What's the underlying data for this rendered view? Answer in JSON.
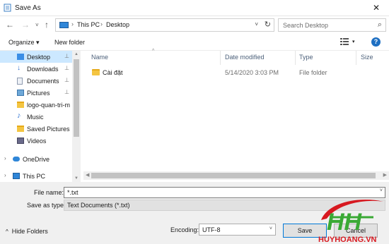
{
  "window": {
    "title": "Save As",
    "close_glyph": "✕"
  },
  "nav": {
    "back": "←",
    "forward": "→",
    "recent": "˅",
    "up": "↑",
    "address": {
      "seg1": "This PC",
      "seg2": "Desktop",
      "sep": "›",
      "drop": "˅",
      "refresh": "↻"
    },
    "search_placeholder": "Search Desktop",
    "search_glyph": "⌕"
  },
  "toolbar": {
    "organize": "Organize ▾",
    "new_folder": "New folder",
    "help": "?"
  },
  "sidebar": {
    "items": [
      {
        "label": "Desktop",
        "icon": "desktop-icon",
        "color": "#3a8ee6"
      },
      {
        "label": "Downloads",
        "icon": "download-icon",
        "color": "#2f6fcf"
      },
      {
        "label": "Documents",
        "icon": "documents-icon",
        "color": "#8f9bb0"
      },
      {
        "label": "Pictures",
        "icon": "pictures-icon",
        "color": "#6ea8d8"
      },
      {
        "label": "logo-quan-tri-m",
        "icon": "folder-icon",
        "color": "#f4c542"
      },
      {
        "label": "Music",
        "icon": "music-icon",
        "color": "#3a7bd5"
      },
      {
        "label": "Saved Pictures",
        "icon": "folder-icon",
        "color": "#f4c542"
      },
      {
        "label": "Videos",
        "icon": "videos-icon",
        "color": "#6a6a8a"
      },
      {
        "label": "OneDrive",
        "icon": "onedrive-icon",
        "color": "#2f86d8"
      },
      {
        "label": "This PC",
        "icon": "computer-icon",
        "color": "#2f86d8"
      }
    ],
    "pin_glyph": "📌",
    "expand_glyph": "›"
  },
  "columns": {
    "name": "Name",
    "date": "Date modified",
    "type": "Type",
    "size": "Size",
    "sort": "^"
  },
  "files": [
    {
      "name": "Cài đặt",
      "date": "5/14/2020 3:03 PM",
      "type": "File folder"
    }
  ],
  "form": {
    "filename_label": "File name:",
    "filename_value": "*.txt",
    "savetype_label": "Save as type:",
    "savetype_value": "Text Documents (*.txt)"
  },
  "footer": {
    "hide_folders": "Hide Folders",
    "hide_arrow": "^",
    "encoding_label": "Encoding:",
    "encoding_value": "UTF-8",
    "save": "Save",
    "cancel": "Cancel"
  },
  "watermark": {
    "text": "HUYHOANG.VN",
    "red": "#d71920",
    "green": "#3aa935"
  }
}
